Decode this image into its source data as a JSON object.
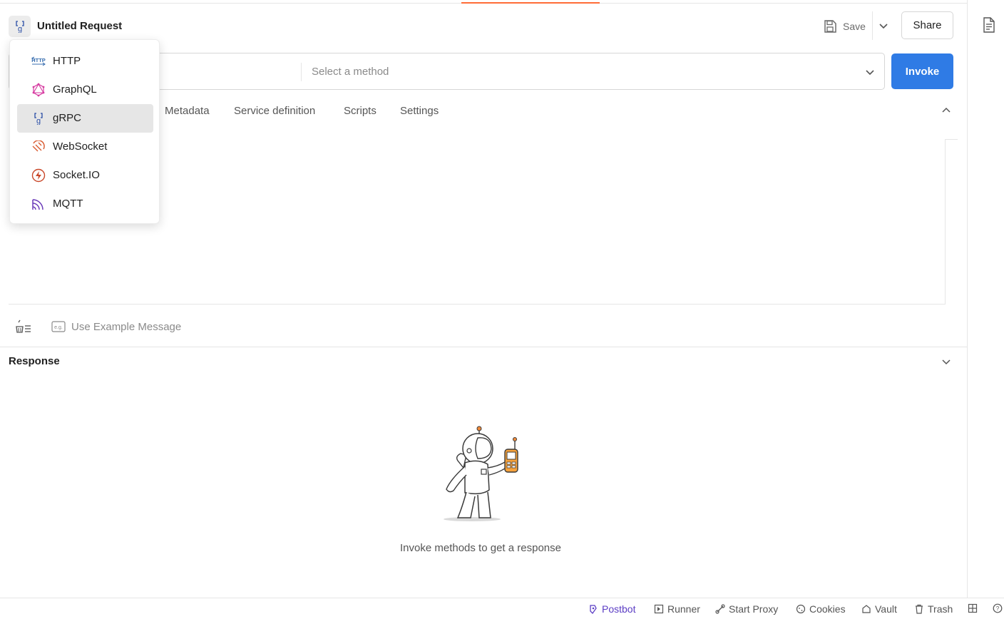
{
  "header": {
    "title": "Untitled Request",
    "save_label": "Save",
    "share_label": "Share"
  },
  "request": {
    "method_placeholder": "Select a method",
    "invoke_label": "Invoke"
  },
  "tabs": [
    "Metadata",
    "Service definition",
    "Scripts",
    "Settings"
  ],
  "editor": {
    "example_label": "Use Example Message",
    "example_badge": "e.g."
  },
  "response": {
    "title": "Response",
    "empty_text": "Invoke methods to get a response"
  },
  "request_type_menu": {
    "selected": "gRPC",
    "items": [
      {
        "label": "HTTP",
        "icon": "http-icon",
        "badge": "HTTP"
      },
      {
        "label": "GraphQL",
        "icon": "graphql-icon"
      },
      {
        "label": "gRPC",
        "icon": "grpc-icon"
      },
      {
        "label": "WebSocket",
        "icon": "websocket-icon"
      },
      {
        "label": "Socket.IO",
        "icon": "socketio-icon"
      },
      {
        "label": "MQTT",
        "icon": "mqtt-icon"
      }
    ]
  },
  "statusbar": {
    "items": [
      "Postbot",
      "Runner",
      "Start Proxy",
      "Cookies",
      "Vault",
      "Trash"
    ]
  },
  "colors": {
    "accent": "#ff6c37",
    "primary_button": "#2f7be5",
    "postbot": "#5b3dc4",
    "grpc_icon": "#2a4ea6",
    "graphql_icon": "#d63aa0",
    "websocket_icon": "#d8562b",
    "socketio_icon": "#c9482a",
    "mqtt_icon": "#6b3bb8"
  }
}
